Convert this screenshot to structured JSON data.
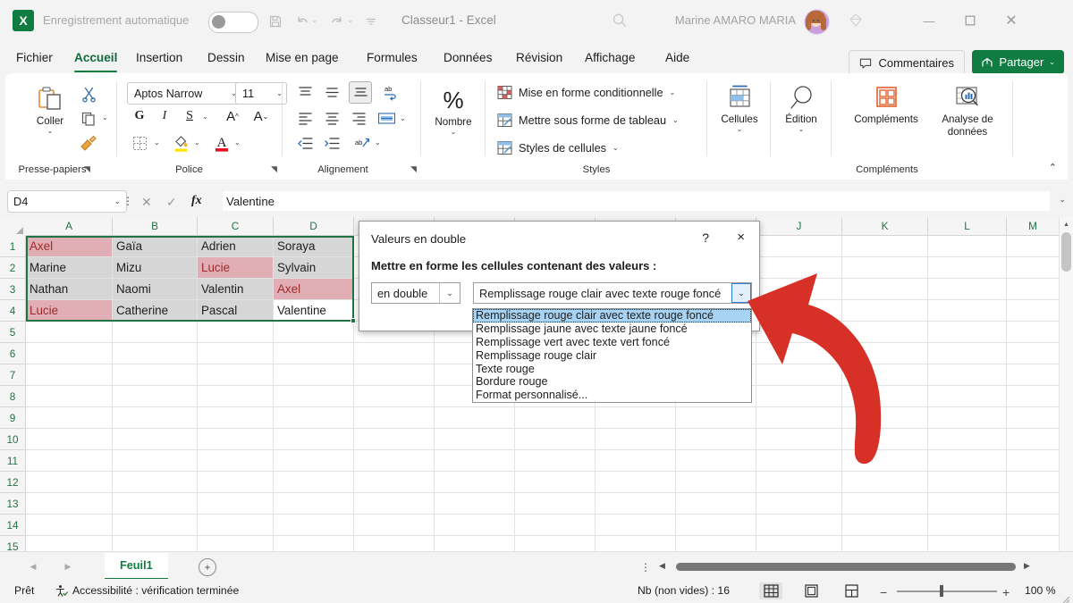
{
  "titlebar": {
    "autosave_label": "Enregistrement automatique",
    "autosave_state": "off",
    "doc_title": "Classeur1 - Excel",
    "user_name": "Marine AMARO MARIA",
    "icons": [
      "save-icon",
      "undo-icon",
      "redo-icon",
      "customize-toolbar-icon",
      "search-icon",
      "diamond-icon"
    ],
    "window_buttons": [
      "minimize",
      "maximize",
      "close"
    ]
  },
  "tabs": [
    {
      "label": "Fichier",
      "active": false
    },
    {
      "label": "Accueil",
      "active": true
    },
    {
      "label": "Insertion",
      "active": false
    },
    {
      "label": "Dessin",
      "active": false
    },
    {
      "label": "Mise en page",
      "active": false
    },
    {
      "label": "Formules",
      "active": false
    },
    {
      "label": "Données",
      "active": false
    },
    {
      "label": "Révision",
      "active": false
    },
    {
      "label": "Affichage",
      "active": false
    },
    {
      "label": "Aide",
      "active": false
    }
  ],
  "header_actions": {
    "comments_label": "Commentaires",
    "share_label": "Partager"
  },
  "ribbon": {
    "groups": [
      {
        "name": "Presse-papiers",
        "label": "Presse-papiers"
      },
      {
        "name": "Police",
        "label": "Police"
      },
      {
        "name": "Alignement",
        "label": "Alignement"
      },
      {
        "name": "Nombre",
        "label": ""
      },
      {
        "name": "Styles",
        "label": "Styles"
      },
      {
        "name": "Cellules",
        "label": ""
      },
      {
        "name": "Edition",
        "label": ""
      },
      {
        "name": "Complements",
        "label": "Compléments"
      }
    ],
    "clipboard": {
      "paste_label": "Coller"
    },
    "font": {
      "family": "Aptos Narrow",
      "size": "11",
      "bold": "G",
      "italic": "I",
      "underline": "S"
    },
    "number": {
      "label": "Nombre"
    },
    "styles": [
      {
        "label": "Mise en forme conditionnelle",
        "icon": "conditional-formatting-icon"
      },
      {
        "label": "Mettre sous forme de tableau",
        "icon": "format-as-table-icon"
      },
      {
        "label": "Styles de cellules",
        "icon": "cell-styles-icon"
      }
    ],
    "cells_label": "Cellules",
    "edition_label": "Édition",
    "addins_label": "Compléments",
    "data_analysis_label": "Analyse de données"
  },
  "formula_bar": {
    "name_box": "D4",
    "formula_value": "Valentine",
    "cancel_icon": "cancel-icon",
    "confirm_icon": "confirm-icon",
    "function_icon": "fx"
  },
  "grid": {
    "columns": [
      "A",
      "B",
      "C",
      "D",
      "E",
      "F",
      "G",
      "H",
      "I",
      "J",
      "K",
      "L",
      "M"
    ],
    "rows": [
      "1",
      "2",
      "3",
      "4",
      "5",
      "6",
      "7",
      "8",
      "9",
      "10",
      "11",
      "12",
      "13",
      "14",
      "15"
    ],
    "data": [
      [
        {
          "v": "Axel",
          "s": "dup"
        },
        {
          "v": "Gaïa",
          "s": "sel"
        },
        {
          "v": "Adrien",
          "s": "sel"
        },
        {
          "v": "Soraya",
          "s": "sel"
        }
      ],
      [
        {
          "v": "Marine",
          "s": "sel"
        },
        {
          "v": "Mizu",
          "s": "sel"
        },
        {
          "v": "Lucie",
          "s": "dup"
        },
        {
          "v": "Sylvain",
          "s": "sel"
        }
      ],
      [
        {
          "v": "Nathan",
          "s": "sel"
        },
        {
          "v": "Naomi",
          "s": "sel"
        },
        {
          "v": "Valentin",
          "s": "sel"
        },
        {
          "v": "Axel",
          "s": "dup"
        }
      ],
      [
        {
          "v": "Lucie",
          "s": "dup"
        },
        {
          "v": "Catherine",
          "s": "sel"
        },
        {
          "v": "Pascal",
          "s": "sel"
        },
        {
          "v": "Valentine",
          "s": "active"
        }
      ]
    ],
    "selection_range": "A1:D4",
    "active_cell": "D4"
  },
  "dialog": {
    "title": "Valeurs en double",
    "help_icon": "?",
    "close_icon": "×",
    "subtitle": "Mettre en forme les cellules contenant des valeurs :",
    "condition_value": "en double",
    "format_value": "Remplissage rouge clair avec texte rouge foncé",
    "options": [
      "Remplissage rouge clair avec texte rouge foncé",
      "Remplissage jaune avec texte jaune foncé",
      "Remplissage vert avec texte vert foncé",
      "Remplissage rouge clair",
      "Texte rouge",
      "Bordure rouge",
      "Format personnalisé..."
    ],
    "selected_index": 0
  },
  "annotation": {
    "arrow_color": "#d63027",
    "name": "red-curved-arrow"
  },
  "sheet_tabs": {
    "tabs": [
      {
        "label": "Feuil1",
        "active": true
      }
    ],
    "add_label": "+"
  },
  "status_bar": {
    "state": "Prêt",
    "accessibility": "Accessibilité : vérification terminée",
    "count_label": "Nb (non vides) : 16",
    "views": [
      "normal-view",
      "page-layout-view",
      "page-break-view"
    ],
    "zoom_value": "100 %"
  },
  "colors": {
    "excel_green": "#107c41",
    "duplicate_fill": "#e0aeb4",
    "duplicate_text": "#9c2b2b",
    "selection_fill": "#d6d6d6",
    "dropdown_highlight": "#a9d3f2",
    "arrow_red": "#d63027"
  }
}
